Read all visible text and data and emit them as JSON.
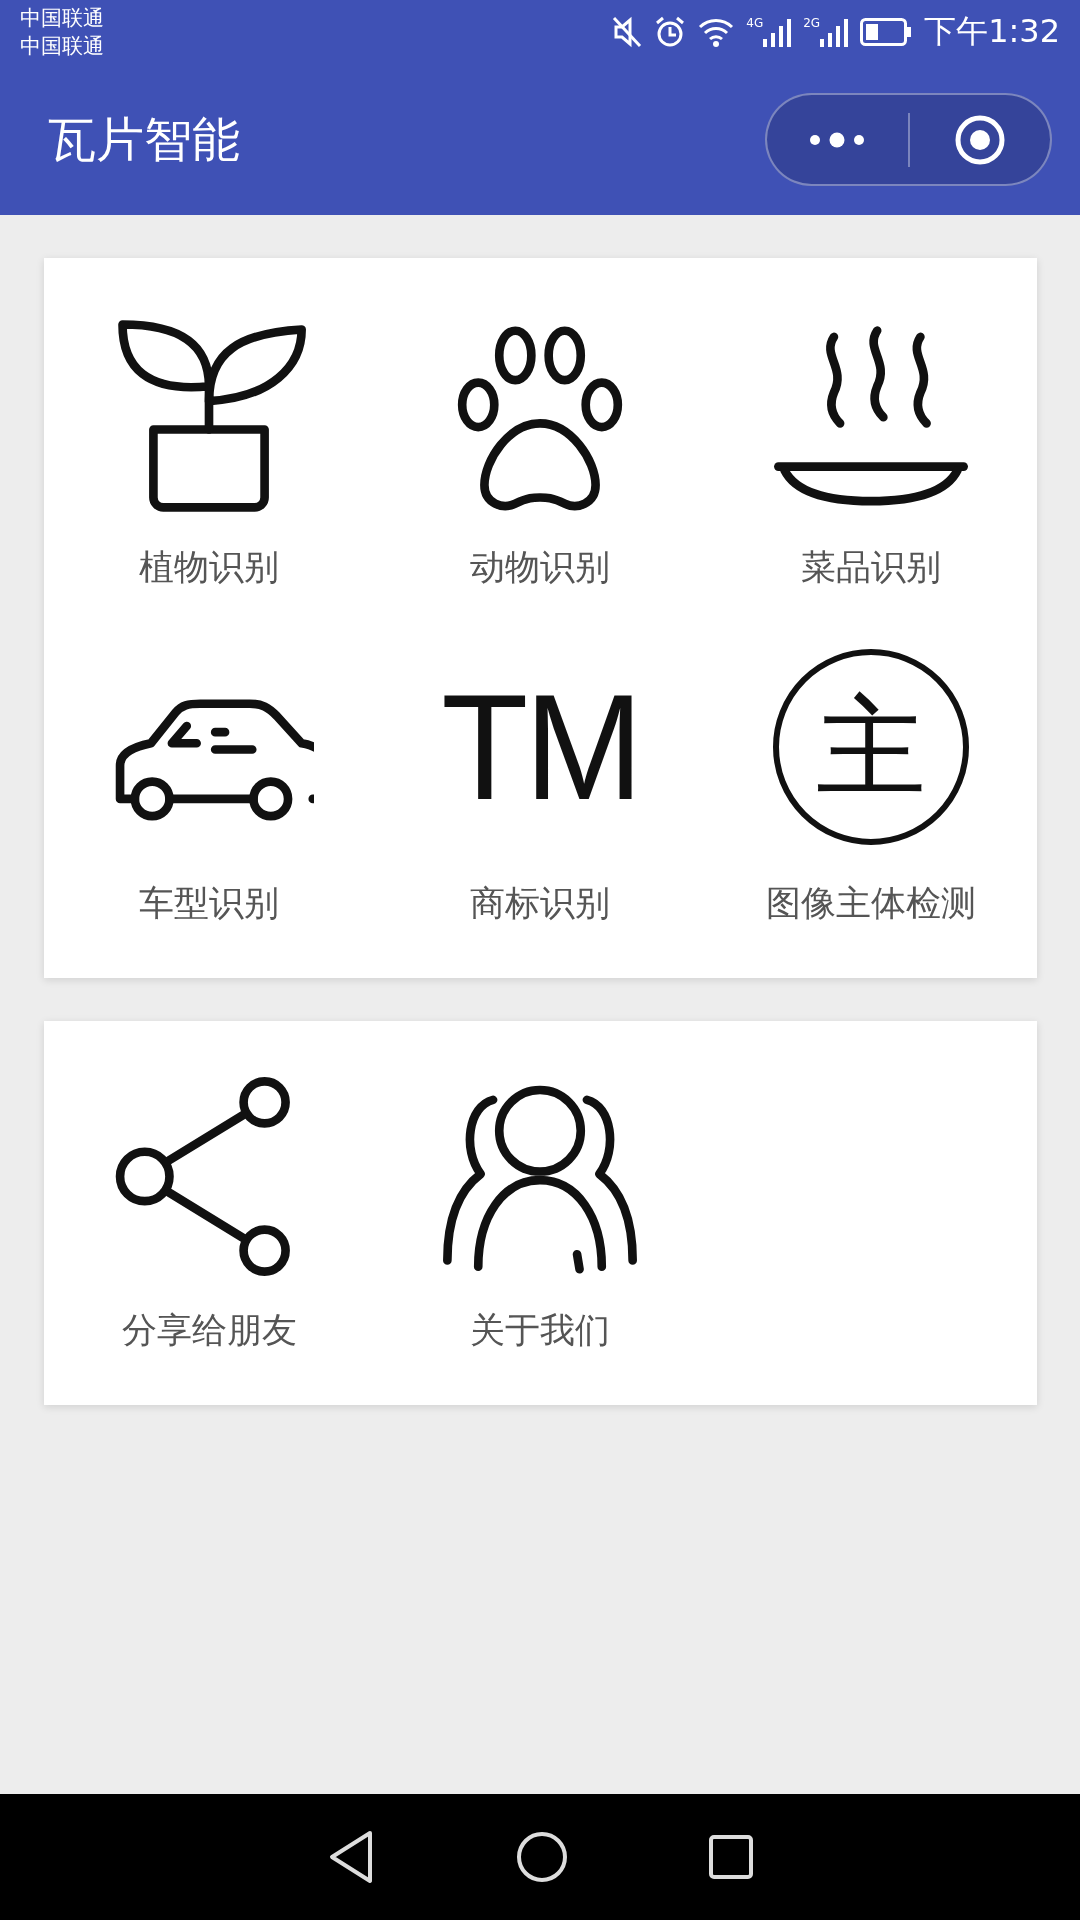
{
  "status_bar": {
    "carriers": [
      "中国联通",
      "中国联通"
    ],
    "networks": [
      "4G",
      "2G"
    ],
    "time": "下午1:32"
  },
  "header": {
    "title": "瓦片智能"
  },
  "sections": [
    {
      "items": [
        {
          "kind": "plant",
          "label": "植物识别"
        },
        {
          "kind": "paw",
          "label": "动物识别"
        },
        {
          "kind": "dish",
          "label": "菜品识别"
        },
        {
          "kind": "car",
          "label": "车型识别"
        },
        {
          "kind": "glyph",
          "glyph": "TM",
          "label": "商标识别"
        },
        {
          "kind": "circled-glyph",
          "glyph": "主",
          "label": "图像主体检测"
        }
      ]
    },
    {
      "items": [
        {
          "kind": "share",
          "label": "分享给朋友"
        },
        {
          "kind": "people",
          "label": "关于我们"
        }
      ]
    }
  ]
}
